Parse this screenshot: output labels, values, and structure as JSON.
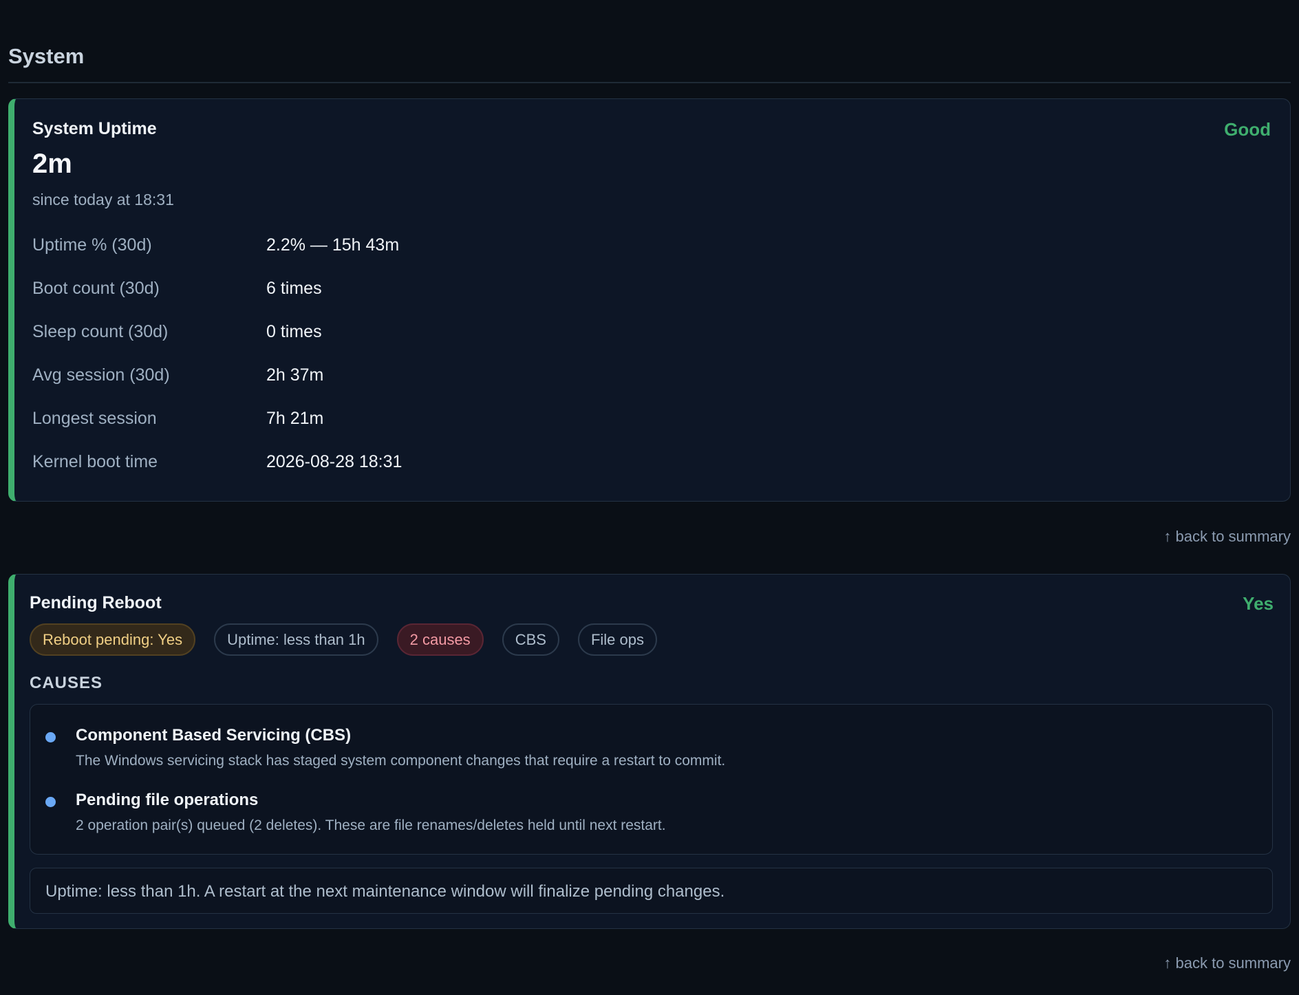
{
  "section": {
    "title": "System"
  },
  "uptime_card": {
    "title": "System Uptime",
    "status": "Good",
    "value": "2m",
    "since": "since today at 18:31",
    "metrics": [
      {
        "label": "Uptime % (30d)",
        "value": "2.2% — 15h 43m"
      },
      {
        "label": "Boot count (30d)",
        "value": "6 times"
      },
      {
        "label": "Sleep count (30d)",
        "value": "0 times"
      },
      {
        "label": "Avg session (30d)",
        "value": "2h 37m"
      },
      {
        "label": "Longest session",
        "value": "7h 21m"
      },
      {
        "label": "Kernel boot time",
        "value": "2026-08-28 18:31"
      }
    ]
  },
  "back_link": {
    "label": "↑ back to summary"
  },
  "reboot_card": {
    "title": "Pending Reboot",
    "status": "Yes",
    "chips": [
      {
        "label": "Reboot pending: Yes",
        "variant": "warn"
      },
      {
        "label": "Uptime: less than 1h",
        "variant": "neutral"
      },
      {
        "label": "2 causes",
        "variant": "danger"
      },
      {
        "label": "CBS",
        "variant": "neutral"
      },
      {
        "label": "File ops",
        "variant": "neutral"
      }
    ],
    "causes_heading": "CAUSES",
    "causes": [
      {
        "title": "Component Based Servicing (CBS)",
        "description": "The Windows servicing stack has staged system component changes that require a restart to commit."
      },
      {
        "title": "Pending file operations",
        "description": "2 operation pair(s) queued (2 deletes). These are file renames/deletes held until next restart."
      }
    ],
    "note": "Uptime: less than 1h. A restart at the next maintenance window will finalize pending changes."
  },
  "colors": {
    "background": "#0a0f16",
    "card": "#0d1626",
    "accent_good": "#3fae6e",
    "bullet": "#6aa8f5",
    "warn_chip": "#33291a",
    "danger_chip": "#3a1a24"
  }
}
